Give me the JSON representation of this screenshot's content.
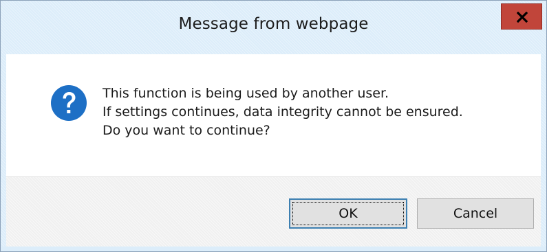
{
  "window": {
    "title": "Message from webpage",
    "close_icon": "close-icon"
  },
  "message": {
    "icon": "question-icon",
    "lines": [
      "This function is being used by another user.",
      "If settings continues, data integrity cannot be ensured.",
      "Do you want to continue?"
    ]
  },
  "buttons": {
    "ok_label": "OK",
    "cancel_label": "Cancel"
  },
  "colors": {
    "titlebar": "#dcedfa",
    "close_button": "#c1453a",
    "icon_blue": "#1d6fc5",
    "focus_border": "#3c7fb1"
  }
}
